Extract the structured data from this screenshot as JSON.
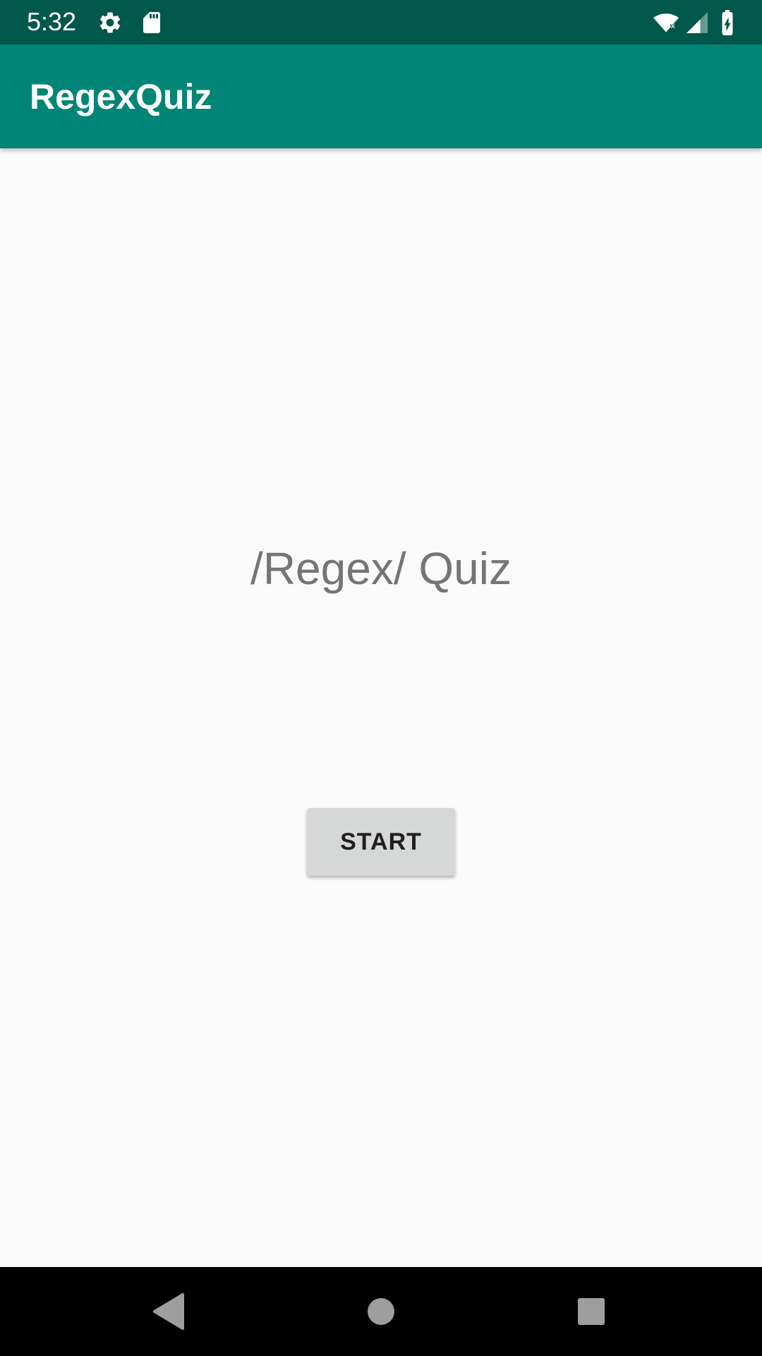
{
  "status_bar": {
    "time": "5:32",
    "icons": [
      "gear-icon",
      "sd-card-icon",
      "wifi-icon",
      "signal-icon",
      "battery-charging-icon"
    ],
    "background_color": "#00574b"
  },
  "app_bar": {
    "title": "RegexQuiz",
    "background_color": "#008577"
  },
  "main": {
    "headline": "/Regex/ Quiz",
    "start_button_label": "START"
  },
  "nav_bar": {
    "buttons": [
      "back-icon",
      "home-icon",
      "recents-icon"
    ]
  }
}
